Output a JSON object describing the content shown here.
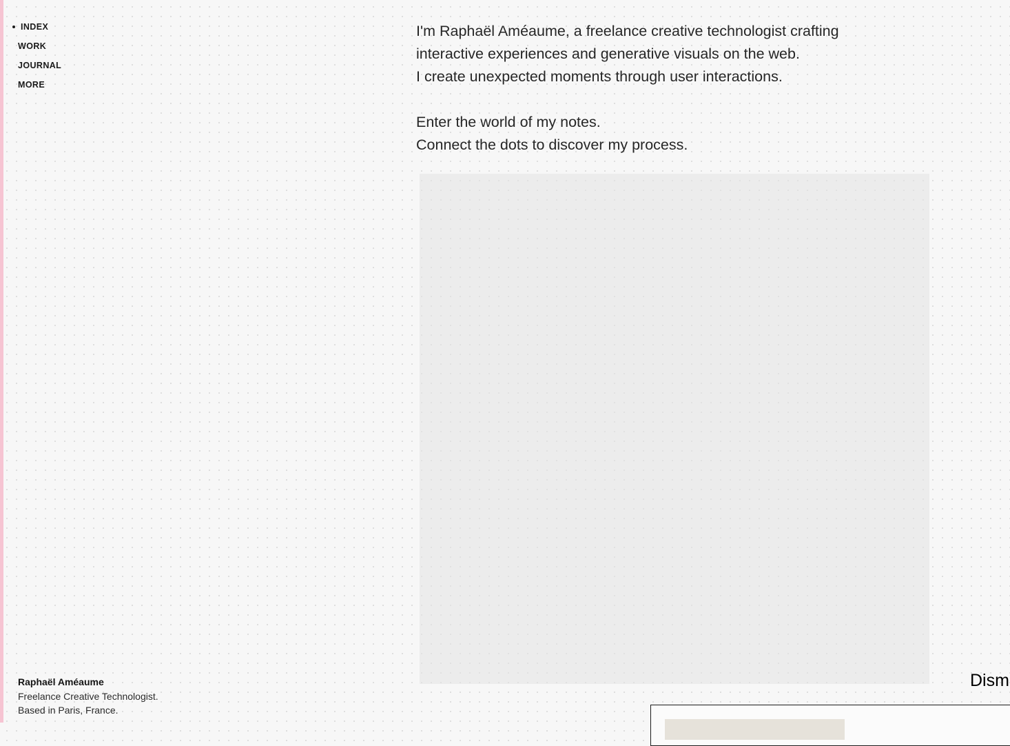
{
  "nav": {
    "items": [
      {
        "label": "INDEX",
        "active": true
      },
      {
        "label": "WORK",
        "active": false
      },
      {
        "label": "JOURNAL",
        "active": false
      },
      {
        "label": "MORE",
        "active": false
      }
    ]
  },
  "intro": {
    "line1": "I'm Raphaël Améaume, a freelance creative technologist crafting",
    "line2": "interactive experiences and generative visuals on the web.",
    "line3": "I create unexpected moments through user interactions.",
    "line4": "Enter the world of my notes.",
    "line5": "Connect the dots to discover my process."
  },
  "footer": {
    "name": "Raphaël Améaume",
    "role": "Freelance Creative Technologist.",
    "location": "Based in Paris, France."
  },
  "dismiss": {
    "label": "Dism"
  },
  "colors": {
    "background": "#f7f7f7",
    "accent_edge": "#f6c4d2",
    "text": "#262626"
  }
}
